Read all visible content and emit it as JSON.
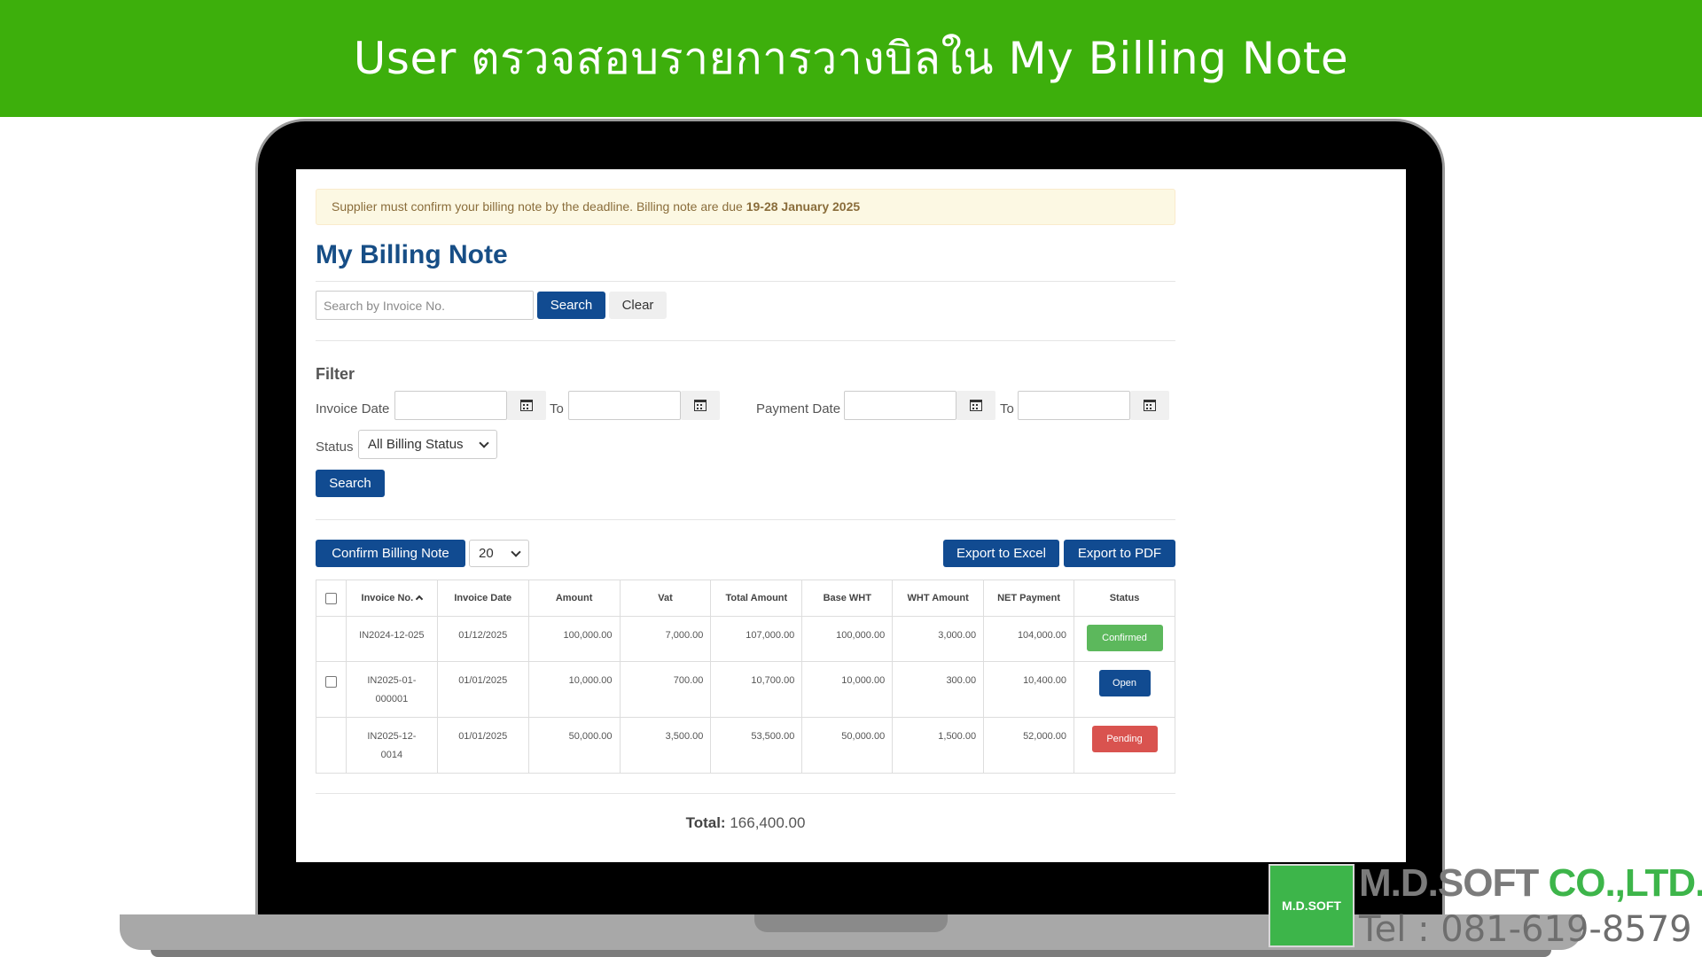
{
  "banner": {
    "title": "User ตรวจสอบรายการวางบิลใน My Billing Note"
  },
  "alert": {
    "text": "Supplier must confirm your billing note by the deadline. Billing note are due ",
    "date_range": "19-28 January 2025"
  },
  "page": {
    "title": "My Billing Note"
  },
  "search": {
    "placeholder": "Search by Invoice No.",
    "search_label": "Search",
    "clear_label": "Clear"
  },
  "filter": {
    "heading": "Filter",
    "invoice_date_label": "Invoice Date",
    "to_label": "To",
    "payment_date_label": "Payment Date",
    "status_label": "Status",
    "status_value": "All Billing Status",
    "search_label": "Search"
  },
  "toolbar": {
    "confirm_label": "Confirm Billing Note",
    "page_size": "20",
    "export_excel_label": "Export to Excel",
    "export_pdf_label": "Export to PDF"
  },
  "table": {
    "headers": [
      "Invoice No.",
      "Invoice Date",
      "Amount",
      "Vat",
      "Total Amount",
      "Base WHT",
      "WHT Amount",
      "NET Payment",
      "Status"
    ],
    "rows": [
      {
        "invoice_no": "IN2024-12-025",
        "invoice_date": "01/12/2025",
        "amount": "100,000.00",
        "vat": "7,000.00",
        "total": "107,000.00",
        "base_wht": "100,000.00",
        "wht": "3,000.00",
        "net": "104,000.00",
        "status": "Confirmed",
        "status_color": "#5cb85c",
        "selectable": false
      },
      {
        "invoice_no": "IN2025-01-000001",
        "invoice_no_l1": "IN2025-01-",
        "invoice_no_l2": "000001",
        "invoice_date": "01/01/2025",
        "amount": "10,000.00",
        "vat": "700.00",
        "total": "10,700.00",
        "base_wht": "10,000.00",
        "wht": "300.00",
        "net": "10,400.00",
        "status": "Open",
        "status_color": "#114b91",
        "selectable": true
      },
      {
        "invoice_no": "IN2025-12-0014",
        "invoice_no_l1": "IN2025-12-",
        "invoice_no_l2": "0014",
        "invoice_date": "01/01/2025",
        "amount": "50,000.00",
        "vat": "3,500.00",
        "total": "53,500.00",
        "base_wht": "50,000.00",
        "wht": "1,500.00",
        "net": "52,000.00",
        "status": "Pending",
        "status_color": "#d9534f",
        "selectable": false
      }
    ]
  },
  "total": {
    "label": "Total:",
    "value": "166,400.00"
  },
  "company": {
    "logo_text": "M.D.SOFT",
    "name_part1": "M.D.SOFT",
    "name_part2": "CO.,LTD.",
    "tel": "Tel : 081-619-8579"
  },
  "colors": {
    "banner": "#3daf0c",
    "primary": "#114b91",
    "brand_green": "#3db54a"
  }
}
